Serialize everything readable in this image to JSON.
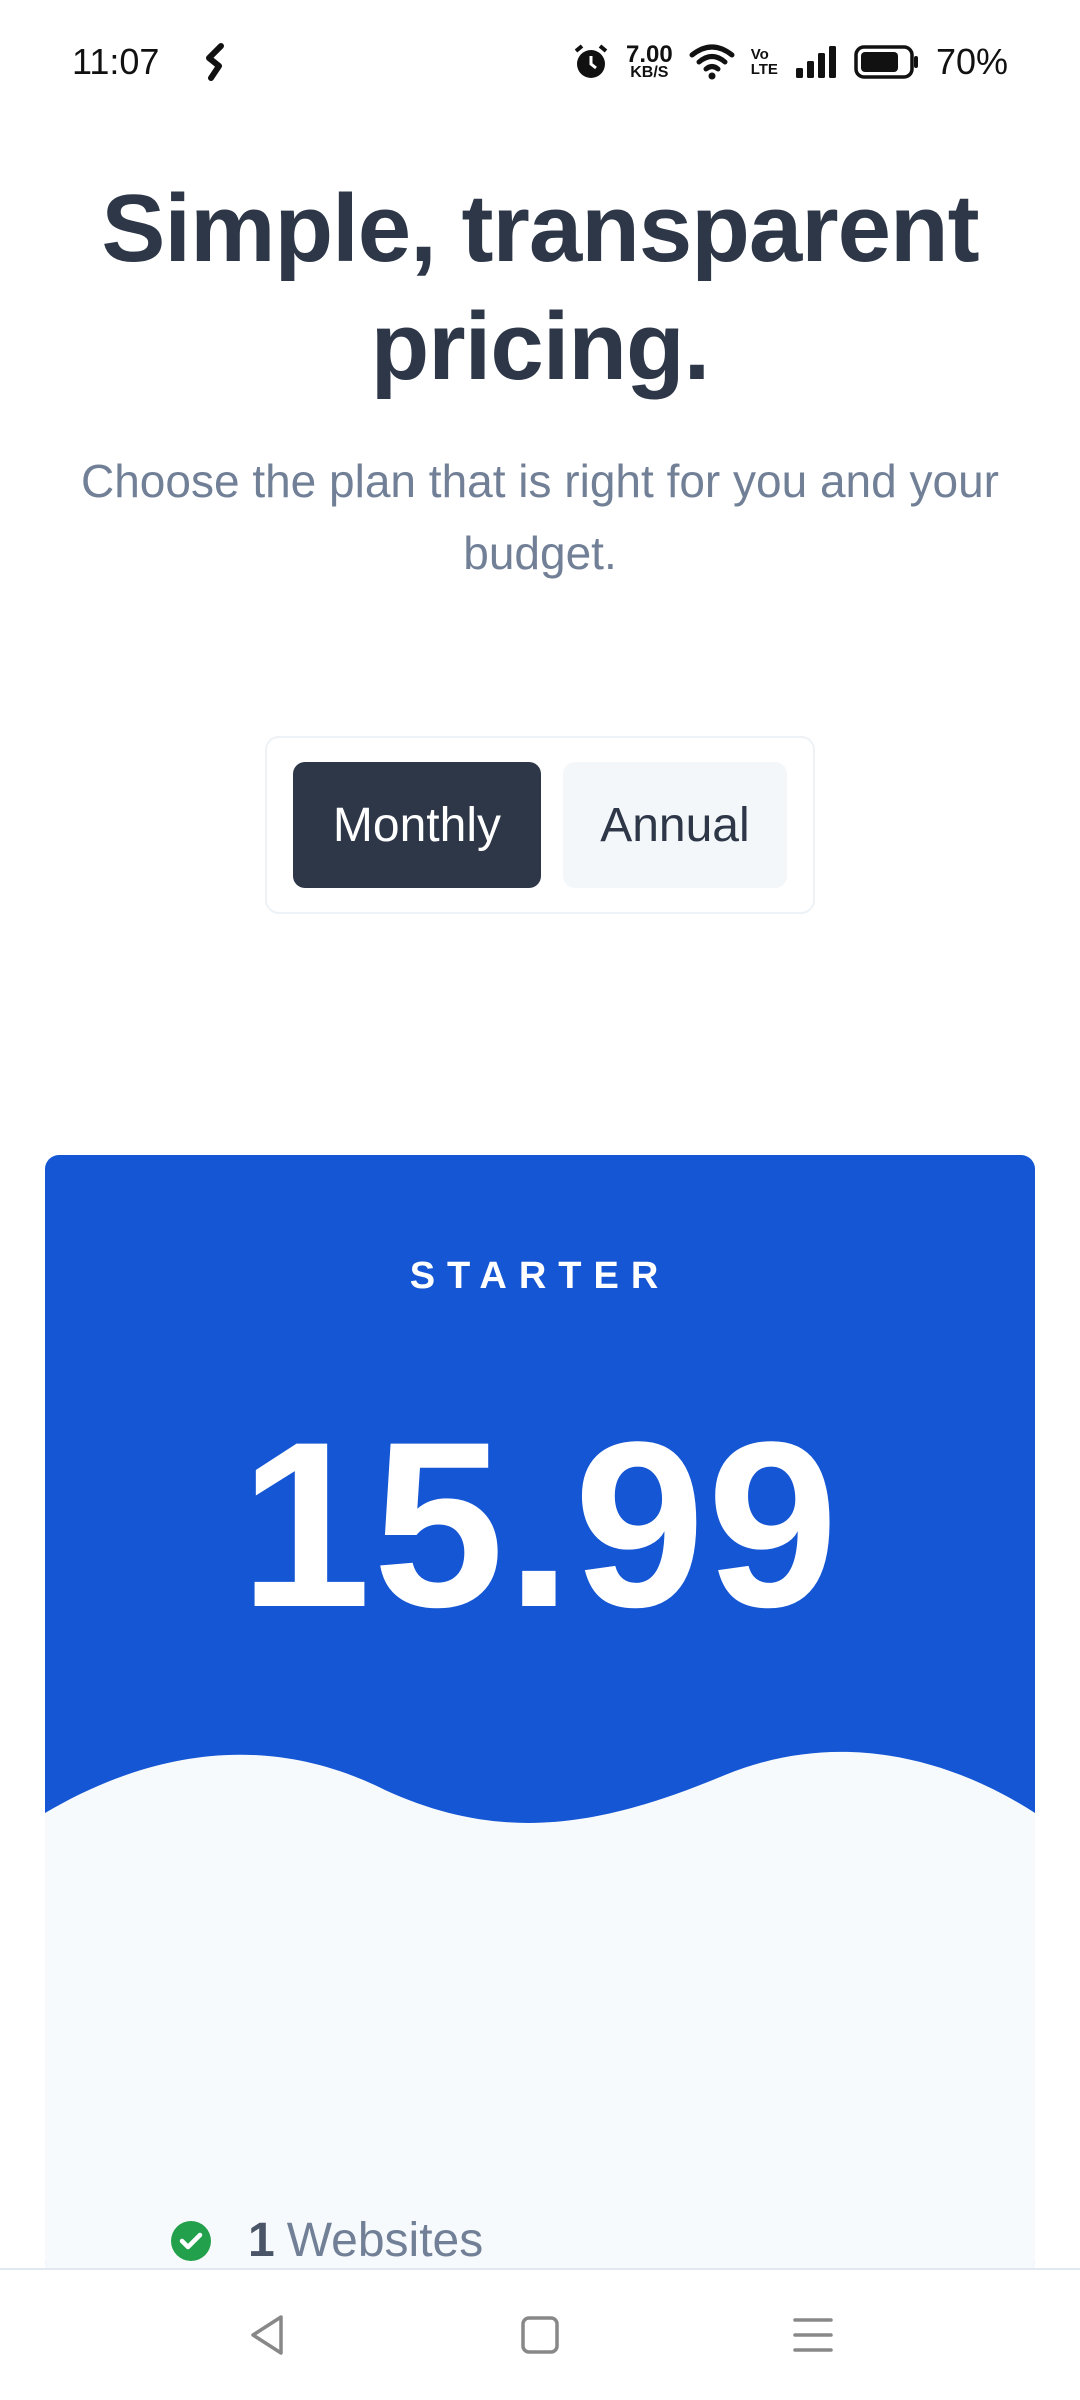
{
  "status_bar": {
    "time": "11:07",
    "speed_value": "7.00",
    "speed_unit": "KB/S",
    "volte_top": "Vo",
    "volte_bottom": "LTE",
    "battery_percent": "70%",
    "icons": [
      "notification-app-icon",
      "alarm-icon",
      "wifi-icon",
      "signal-icon",
      "battery-icon"
    ]
  },
  "header": {
    "title": "Simple, transparent pricing.",
    "subtitle": "Choose the plan that is right for you and your budget."
  },
  "billing_toggle": {
    "options": [
      {
        "label": "Monthly",
        "selected": true
      },
      {
        "label": "Annual",
        "selected": false
      }
    ]
  },
  "plan": {
    "name": "STARTER",
    "price": "15.99",
    "features": [
      {
        "number": "1",
        "label": "Websites",
        "icon": "check-circle-icon"
      }
    ]
  },
  "nav_bar": {
    "buttons": [
      "back-icon",
      "home-icon",
      "menu-icon"
    ]
  },
  "colors": {
    "title": "#2d3748",
    "subtitle": "#718096",
    "card_blue": "#1556d4",
    "wave_light": "#8fabe6",
    "card_bottom": "#f7fafc",
    "check_green": "#22a04b",
    "toggle_active": "#2d3748"
  }
}
